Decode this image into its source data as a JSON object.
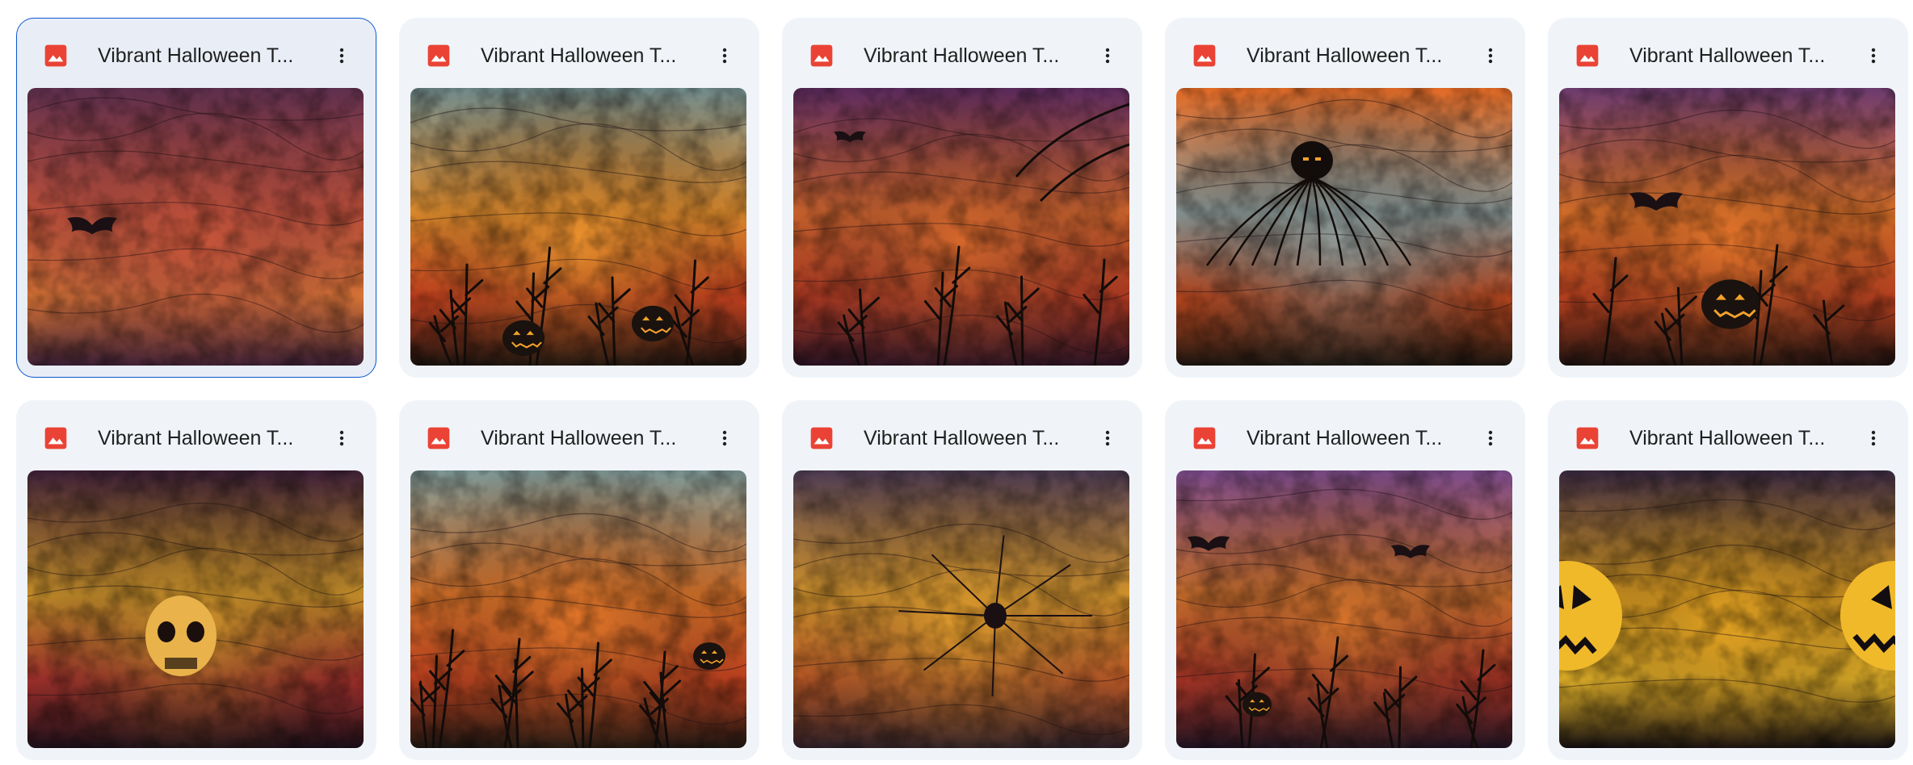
{
  "files": [
    {
      "name": "Vibrant Halloween T...",
      "icon": "image-file-icon",
      "selected": true,
      "colors": [
        "#5e2f4e",
        "#c9543a",
        "#e47a35",
        "#3a1f35"
      ],
      "motif": "bat"
    },
    {
      "name": "Vibrant Halloween T...",
      "icon": "image-file-icon",
      "selected": false,
      "colors": [
        "#6f8a8c",
        "#f0962e",
        "#d4441f",
        "#1a1410"
      ],
      "motif": "pumpkins"
    },
    {
      "name": "Vibrant Halloween T...",
      "icon": "image-file-icon",
      "selected": false,
      "colors": [
        "#5b2a5e",
        "#d86a2c",
        "#b43a20",
        "#2a1424"
      ],
      "motif": "branches"
    },
    {
      "name": "Vibrant Halloween T...",
      "icon": "image-file-icon",
      "selected": false,
      "colors": [
        "#e36a25",
        "#8fa0a0",
        "#c64a1e",
        "#1a1510"
      ],
      "motif": "spider"
    },
    {
      "name": "Vibrant Halloween T...",
      "icon": "image-file-icon",
      "selected": false,
      "colors": [
        "#6b3a6e",
        "#e9782b",
        "#c24320",
        "#1c1210"
      ],
      "motif": "pumpkin-bat"
    },
    {
      "name": "Vibrant Halloween T...",
      "icon": "image-file-icon",
      "selected": false,
      "colors": [
        "#3c1f36",
        "#d59a2a",
        "#a8302c",
        "#1a0f18"
      ],
      "motif": "skull"
    },
    {
      "name": "Vibrant Halloween T...",
      "icon": "image-file-icon",
      "selected": false,
      "colors": [
        "#7c9796",
        "#ea7b2a",
        "#c9421f",
        "#1c1612"
      ],
      "motif": "grass"
    },
    {
      "name": "Vibrant Halloween T...",
      "icon": "image-file-icon",
      "selected": false,
      "colors": [
        "#4b3a52",
        "#e5a12c",
        "#c25a25",
        "#2a1e26"
      ],
      "motif": "spider-web"
    },
    {
      "name": "Vibrant Halloween T...",
      "icon": "image-file-icon",
      "selected": false,
      "colors": [
        "#7a4a8a",
        "#d9772c",
        "#b03524",
        "#1c1220"
      ],
      "motif": "bats"
    },
    {
      "name": "Vibrant Halloween T...",
      "icon": "image-file-icon",
      "selected": false,
      "colors": [
        "#3b2a42",
        "#e8a521",
        "#f4c02a",
        "#120d10"
      ],
      "motif": "jack-o-lanterns"
    }
  ],
  "brand": {
    "icon_color": "#ea4335",
    "selection_border": "#0b57d0"
  }
}
